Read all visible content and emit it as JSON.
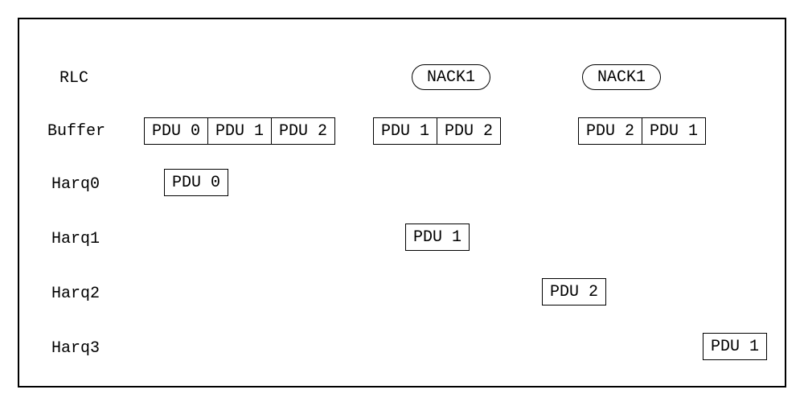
{
  "rows": {
    "rlc": "RLC",
    "buffer": "Buffer",
    "harq0": "Harq0",
    "harq1": "Harq1",
    "harq2": "Harq2",
    "harq3": "Harq3"
  },
  "nack": {
    "n1": "NACK1",
    "n2": "NACK1"
  },
  "buf": {
    "g1": {
      "p0": "PDU 0",
      "p1": "PDU 1",
      "p2": "PDU 2"
    },
    "g2": {
      "p1": "PDU 1",
      "p2": "PDU 2"
    },
    "g3": {
      "p2": "PDU 2",
      "p1": "PDU 1"
    }
  },
  "harq": {
    "h0": "PDU 0",
    "h1": "PDU 1",
    "h2": "PDU 2",
    "h3": "PDU 1"
  }
}
